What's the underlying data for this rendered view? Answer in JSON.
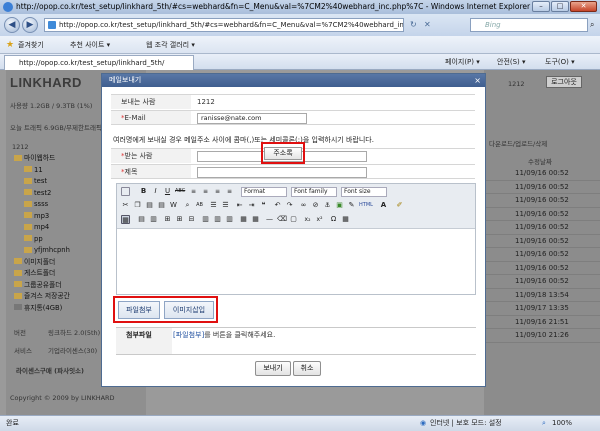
{
  "browser": {
    "title": "http://opop.co.kr/test_setup/linkhard_5th/#cs=webhard&fn=C_Menu&val=%7CM2%40webhard_inc.php%7C - Windows Internet Explorer",
    "address": "http://opop.co.kr/test_setup/linkhard_5th/#cs=webhard&fn=C_Menu&val=%7CM2%40webhard_inc.php",
    "search_placeholder": "Bing",
    "favorites_label": "즐겨찾기",
    "suggested_sites": "추천 사이트 ▾",
    "web_slice_gallery": "웹 조각 갤러리 ▾",
    "tab_label": "http://opop.co.kr/test_setup/linkhard_5th/",
    "cmd_page": "페이지(P) ▾",
    "cmd_safety": "안전(S) ▾",
    "cmd_tools": "도구(O) ▾",
    "status_left": "완료",
    "status_zone": "인터넷 | 보호 모드: 설정",
    "zoom": "100%"
  },
  "page": {
    "logo": "LINKHARD",
    "usage": "사용량 1.2GB / 9.3TB (1%)",
    "traffic": "오늘 트래픽 6.9GB/무제한트래픽",
    "usage_count": "1212",
    "tree": [
      {
        "label": "마이웹하드"
      },
      {
        "label": "11"
      },
      {
        "label": "test"
      },
      {
        "label": "test2"
      },
      {
        "label": "ssss"
      },
      {
        "label": "mp3"
      },
      {
        "label": "mp4"
      },
      {
        "label": "pp"
      },
      {
        "label": "yfjmhcpnh"
      },
      {
        "label": "이미지폴더"
      },
      {
        "label": "게스트폴더"
      },
      {
        "label": "그룹공유폴더"
      },
      {
        "label": "즐겨스 저장공간"
      },
      {
        "label": "휴지통(4GB)"
      }
    ],
    "bottom_version_label": "버전",
    "bottom_version_value": "링크하드 2.0(5th)",
    "bottom_service_label": "서비스",
    "bottom_service_value": "기업라이센스(30)",
    "license_link": "라이센스구매 (파사잇소)",
    "copyright": "Copyright © 2009 by LINKHARD",
    "user_num": "1212",
    "logout": "로그아웃",
    "col_headers": "다운로드/업로드/삭제",
    "col_date": "수정날짜",
    "dates": [
      "11/09/16 00:52",
      "11/09/16 00:52",
      "11/09/16 00:52",
      "11/09/16 00:52",
      "11/09/16 00:52",
      "11/09/16 00:52",
      "11/09/16 00:52",
      "11/09/16 00:52",
      "11/09/16 00:52",
      "11/09/18 13:54",
      "11/09/17 13:35",
      "11/09/16 21:51",
      "11/09/10 21:26"
    ]
  },
  "dialog": {
    "title": "메일보내기",
    "close": "×",
    "sender_label": "보내는 사람",
    "sender_value": "1212",
    "email_label": "E-Mail",
    "email_value": "ranisse@nate.com",
    "notice": "여러명에게 보내실 경우 메일주소 사이에 콤마(,)또는 세미콜론(;)을 입력하시기 바랍니다.",
    "recipient_label": "받는 사람",
    "address_book": "주소록",
    "subject_label": "제목",
    "toolbar": {
      "format": "Format",
      "font_family": "Font family",
      "font_size": "Font size"
    },
    "attach_button": "파일첨부",
    "insert_image": "이미지삽입",
    "attach_label": "첨부파일",
    "attach_hint_link": "[파일첨부]",
    "attach_hint": "를 버튼을 클릭해주세요.",
    "send": "보내기",
    "cancel": "취소"
  }
}
